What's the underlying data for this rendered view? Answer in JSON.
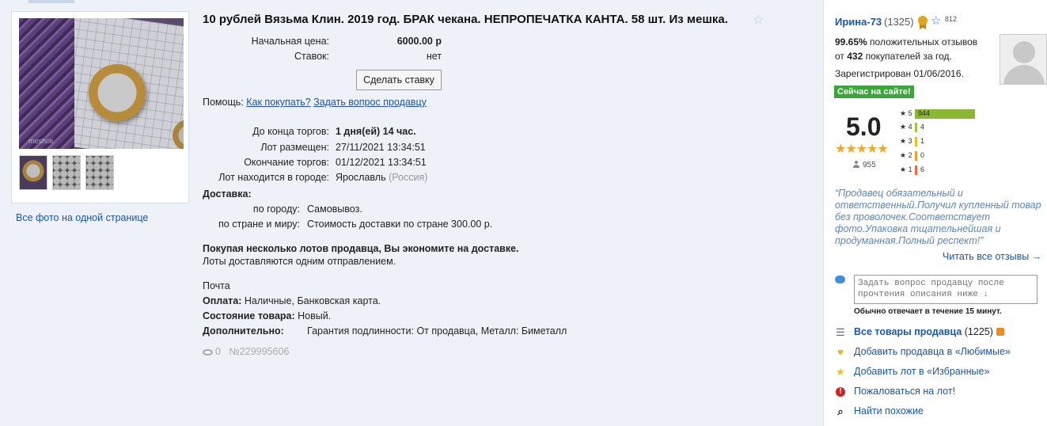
{
  "lot": {
    "title": "10 рублей Вязьма Клин. 2019 год. БРАК чекана. НЕПРОПЕЧАТКА КАНТА. 58 шт. Из мешка.",
    "start_price_label": "Начальная цена:",
    "start_price": "6000.00 р",
    "bids_label": "Ставок:",
    "bids": "нет",
    "bid_button": "Сделать ставку",
    "help_label": "Помощь:",
    "help_link_1": "Как покупать?",
    "help_link_2": "Задать вопрос продавцу",
    "ends_in_label": "До конца торгов:",
    "ends_in": "1 дня(ей) 14 час.",
    "posted_label": "Лот размещен:",
    "posted": "27/11/2021 13:34:51",
    "end_label": "Окончание торгов:",
    "end": "01/12/2021 13:34:51",
    "city_label": "Лот находится в городе:",
    "city": "Ярославль",
    "country": "(Россия)",
    "delivery_label": "Доставка:",
    "delivery_city_label": "по городу:",
    "delivery_city": "Самовывоз.",
    "delivery_world_label": "по стране и миру:",
    "delivery_world": "Стоимость доставки по стране 300.00 р.",
    "save_note": "Покупая несколько лотов продавца, Вы экономите на доставке.",
    "ship_note": "Лоты доставляются одним отправлением.",
    "post": "Почта",
    "payment_label": "Оплата:",
    "payment": "Наличные, Банковская карта.",
    "condition_label": "Состояние товара:",
    "condition": "Новый.",
    "extra_label": "Дополнительно:",
    "extra": "Гарантия подлинности: От продавца, Металл: Биметалл",
    "views": "0",
    "lot_number": "№229995606"
  },
  "photos": {
    "watermark": "meshok",
    "all_photos_link": "Все фото на одной странице"
  },
  "seller": {
    "name": "Ирина-73",
    "count": "(1325)",
    "star_count": "812",
    "positive_pct": "99.65%",
    "positive_text": "положительных отзывов",
    "from_text": "от",
    "buyers": "432",
    "buyers_text": "покупателей за год.",
    "registered": "Зарегистрирован 01/06/2016.",
    "online": "Сейчас на сайте!",
    "rating": "5.0",
    "votes": "955",
    "ratings": [
      {
        "stars": "5",
        "count": "944",
        "color": "#8bb832",
        "share": 1.0
      },
      {
        "stars": "4",
        "count": "4",
        "color": "#a6c436",
        "share": 0.02
      },
      {
        "stars": "3",
        "count": "1",
        "color": "#f0c020",
        "share": 0.02
      },
      {
        "stars": "2",
        "count": "0",
        "color": "#f0a020",
        "share": 0.01
      },
      {
        "stars": "1",
        "count": "6",
        "color": "#ee6a3a",
        "share": 0.02
      }
    ],
    "quote": "“Продавец обязательный и ответственный.Получил купленный товар без проволочек.Соответствует фото.Упаковка тщательнейшая и продуманная.Полный респект!”",
    "read_all": "Читать все отзывы →",
    "ask_placeholder": "Задать вопрос продавцу после прочтения описания ниже ↓",
    "reply_note": "Обычно отвечает в течение 15 минут."
  },
  "actions": [
    {
      "label": "Все товары продавца",
      "extra": "(1225)",
      "icon": "list-icon"
    },
    {
      "label": "Добавить продавца в «Любимые»",
      "icon": "heart-icon"
    },
    {
      "label": "Добавить лот в «Избранные»",
      "icon": "star-icon"
    },
    {
      "label": "Пожаловаться на лот!",
      "icon": "alert-icon"
    },
    {
      "label": "Найти похожие",
      "icon": "search-icon"
    }
  ]
}
